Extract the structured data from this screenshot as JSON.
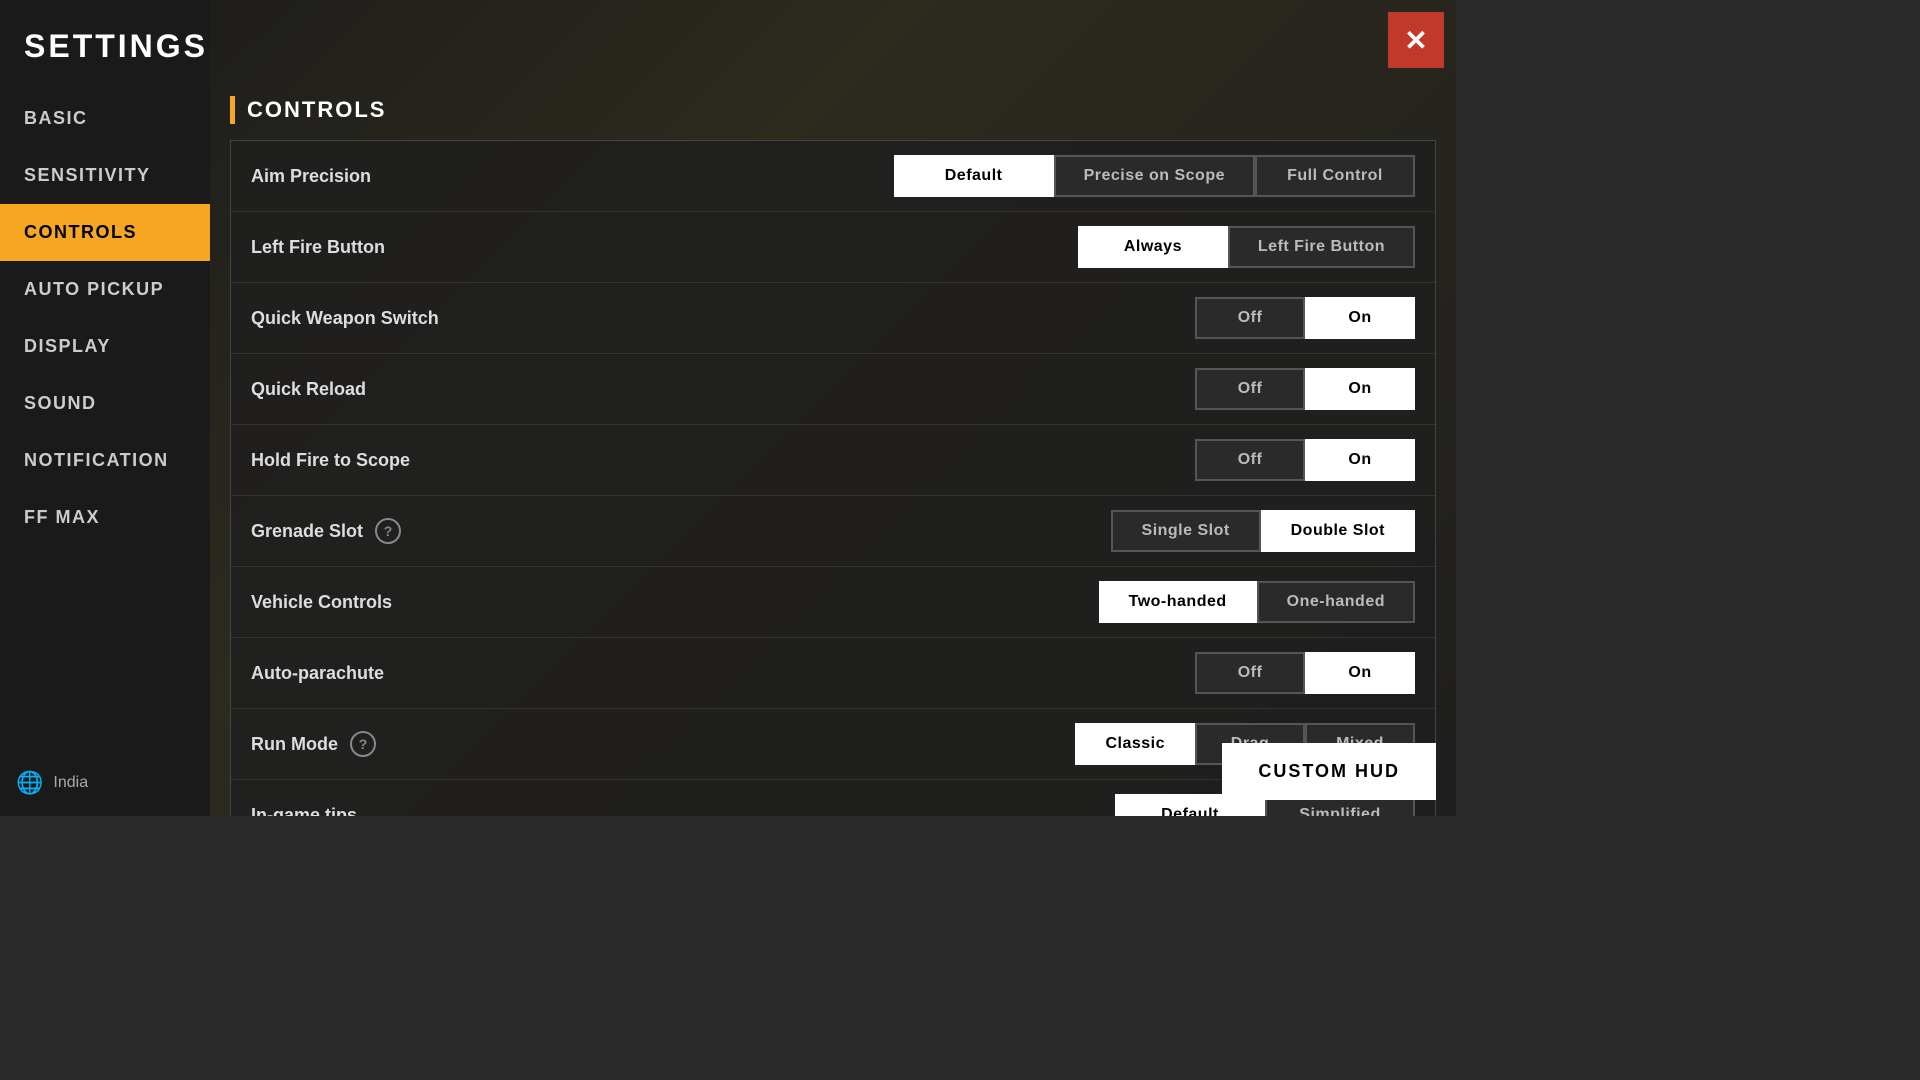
{
  "app": {
    "title": "SETTINGS",
    "close_icon": "✕"
  },
  "sidebar": {
    "items": [
      {
        "id": "basic",
        "label": "BASIC",
        "active": false
      },
      {
        "id": "sensitivity",
        "label": "SENSITIVITY",
        "active": false
      },
      {
        "id": "controls",
        "label": "CONTROLS",
        "active": true
      },
      {
        "id": "auto-pickup",
        "label": "AUTO PICKUP",
        "active": false
      },
      {
        "id": "display",
        "label": "DISPLAY",
        "active": false
      },
      {
        "id": "sound",
        "label": "SOUND",
        "active": false
      },
      {
        "id": "notification",
        "label": "NOTIFICATION",
        "active": false
      },
      {
        "id": "ff-max",
        "label": "FF MAX",
        "active": false
      }
    ],
    "footer": {
      "icon": "🌐",
      "label": "India"
    }
  },
  "controls_section": {
    "title": "CONTROLS",
    "settings": [
      {
        "id": "aim-precision",
        "label": "Aim Precision",
        "has_help": false,
        "options": [
          "Default",
          "Precise on Scope",
          "Full Control"
        ],
        "active_index": 0
      },
      {
        "id": "left-fire-button",
        "label": "Left Fire Button",
        "has_help": false,
        "options": [
          "Always",
          "Left Fire Button"
        ],
        "active_index": 0
      },
      {
        "id": "quick-weapon-switch",
        "label": "Quick Weapon Switch",
        "has_help": false,
        "options": [
          "Off",
          "On"
        ],
        "active_index": 1
      },
      {
        "id": "quick-reload",
        "label": "Quick Reload",
        "has_help": false,
        "options": [
          "Off",
          "On"
        ],
        "active_index": 1
      },
      {
        "id": "hold-fire-to-scope",
        "label": "Hold Fire to Scope",
        "has_help": false,
        "options": [
          "Off",
          "On"
        ],
        "active_index": 1
      },
      {
        "id": "grenade-slot",
        "label": "Grenade Slot",
        "has_help": true,
        "options": [
          "Single Slot",
          "Double Slot"
        ],
        "active_index": 1
      },
      {
        "id": "vehicle-controls",
        "label": "Vehicle Controls",
        "has_help": false,
        "options": [
          "Two-handed",
          "One-handed"
        ],
        "active_index": 0
      },
      {
        "id": "auto-parachute",
        "label": "Auto-parachute",
        "has_help": false,
        "options": [
          "Off",
          "On"
        ],
        "active_index": 1
      },
      {
        "id": "run-mode",
        "label": "Run Mode",
        "has_help": true,
        "options": [
          "Classic",
          "Drag",
          "Mixed"
        ],
        "active_index": 0
      },
      {
        "id": "in-game-tips",
        "label": "In-game tips",
        "has_help": false,
        "options": [
          "Default",
          "Simplified"
        ],
        "active_index": 0
      }
    ]
  },
  "custom_hud_button": "CUSTOM HUD",
  "scroll_icon": "⌄"
}
